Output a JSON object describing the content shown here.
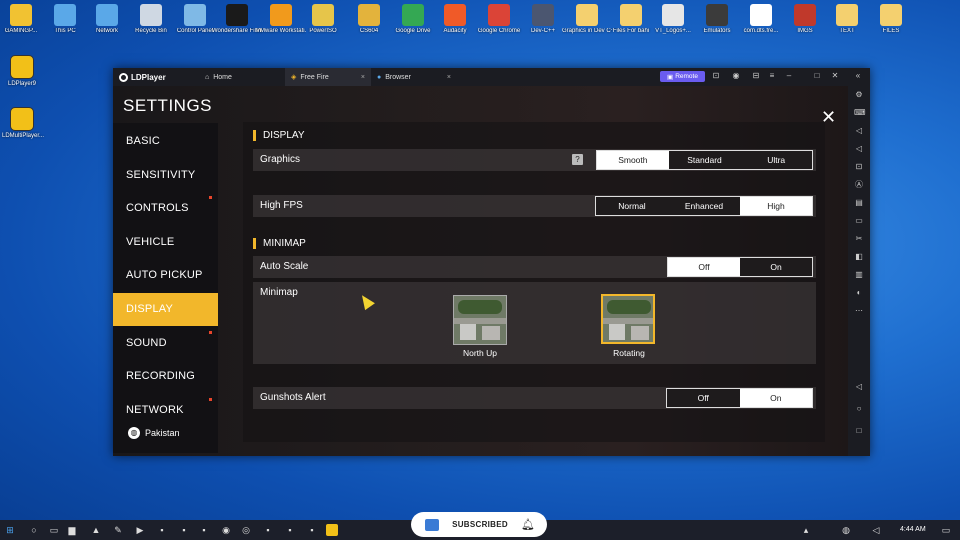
{
  "desktop": {
    "icons": [
      {
        "label": "GAMINGP...",
        "color": "#f1c232"
      },
      {
        "label": "This PC",
        "color": "#5aa8e8"
      },
      {
        "label": "Network",
        "color": "#5aa8e8"
      },
      {
        "label": "Recycle Bin",
        "color": "#cfd8e3"
      },
      {
        "label": "Control Panel",
        "color": "#7fb9e6"
      },
      {
        "label": "Wondershare Filmora 12",
        "color": "#1a1a1a"
      },
      {
        "label": "VMware Workstati...",
        "color": "#f19a1c"
      },
      {
        "label": "PowerISO",
        "color": "#e6c54a"
      },
      {
        "label": "CS604",
        "color": "#e3b33c"
      },
      {
        "label": "Google Drive",
        "color": "#34a853"
      },
      {
        "label": "Audacity",
        "color": "#f05a28"
      },
      {
        "label": "Google Chrome",
        "color": "#db4437"
      },
      {
        "label": "Dev-C++",
        "color": "#4b5670"
      },
      {
        "label": "Graphics in Dev C++",
        "color": "#f4d06f"
      },
      {
        "label": "Files For bahi",
        "color": "#f4d06f"
      },
      {
        "label": "VT_Logos+...",
        "color": "#e6e6e6"
      },
      {
        "label": "Emulators",
        "color": "#3b3b3b"
      },
      {
        "label": "com.dts.fre...",
        "color": "#ffffff"
      },
      {
        "label": "IMGS",
        "color": "#c0392b"
      },
      {
        "label": "TEXT",
        "color": "#f4d06f"
      },
      {
        "label": "FILES",
        "color": "#f4d06f"
      }
    ],
    "side_icons": [
      {
        "label": "LDPlayer9"
      },
      {
        "label": "LDMultiPlayer..."
      }
    ]
  },
  "window": {
    "brand": "LDPlayer",
    "tabs": [
      {
        "label": "Home",
        "icon": "home-icon",
        "active": false
      },
      {
        "label": "Free Fire",
        "icon": "game-icon",
        "active": true
      },
      {
        "label": "Browser",
        "icon": "browser-icon",
        "active": false
      }
    ],
    "remote_label": "Remote",
    "tab_close": "×"
  },
  "settings": {
    "title": "SETTINGS",
    "menu": [
      {
        "label": "BASIC",
        "active": false,
        "dot": false
      },
      {
        "label": "SENSITIVITY",
        "active": false,
        "dot": false
      },
      {
        "label": "CONTROLS",
        "active": false,
        "dot": true
      },
      {
        "label": "VEHICLE",
        "active": false,
        "dot": false
      },
      {
        "label": "AUTO PICKUP",
        "active": false,
        "dot": false
      },
      {
        "label": "DISPLAY",
        "active": true,
        "dot": false
      },
      {
        "label": "SOUND",
        "active": false,
        "dot": true
      },
      {
        "label": "RECORDING",
        "active": false,
        "dot": false
      },
      {
        "label": "NETWORK",
        "active": false,
        "dot": true
      }
    ],
    "region": "Pakistan",
    "display_section": "DISPLAY",
    "graphics": {
      "label": "Graphics",
      "help": "?",
      "options": [
        "Smooth",
        "Standard",
        "Ultra"
      ],
      "selected": 0
    },
    "high_fps": {
      "label": "High FPS",
      "options": [
        "Normal",
        "Enhanced",
        "High"
      ],
      "selected": 2
    },
    "minimap_section": "MINIMAP",
    "auto_scale": {
      "label": "Auto Scale",
      "options": [
        "Off",
        "On"
      ],
      "selected": 0
    },
    "minimap": {
      "label": "Minimap",
      "choices": [
        "North Up",
        "Rotating"
      ],
      "selected": 1
    },
    "gunshots_alert": {
      "label": "Gunshots Alert",
      "options": [
        "Off",
        "On"
      ],
      "selected": 1
    }
  },
  "taskbar": {
    "time": "4:44 AM"
  },
  "overlay": {
    "subscribed": "SUBSCRIBED"
  }
}
